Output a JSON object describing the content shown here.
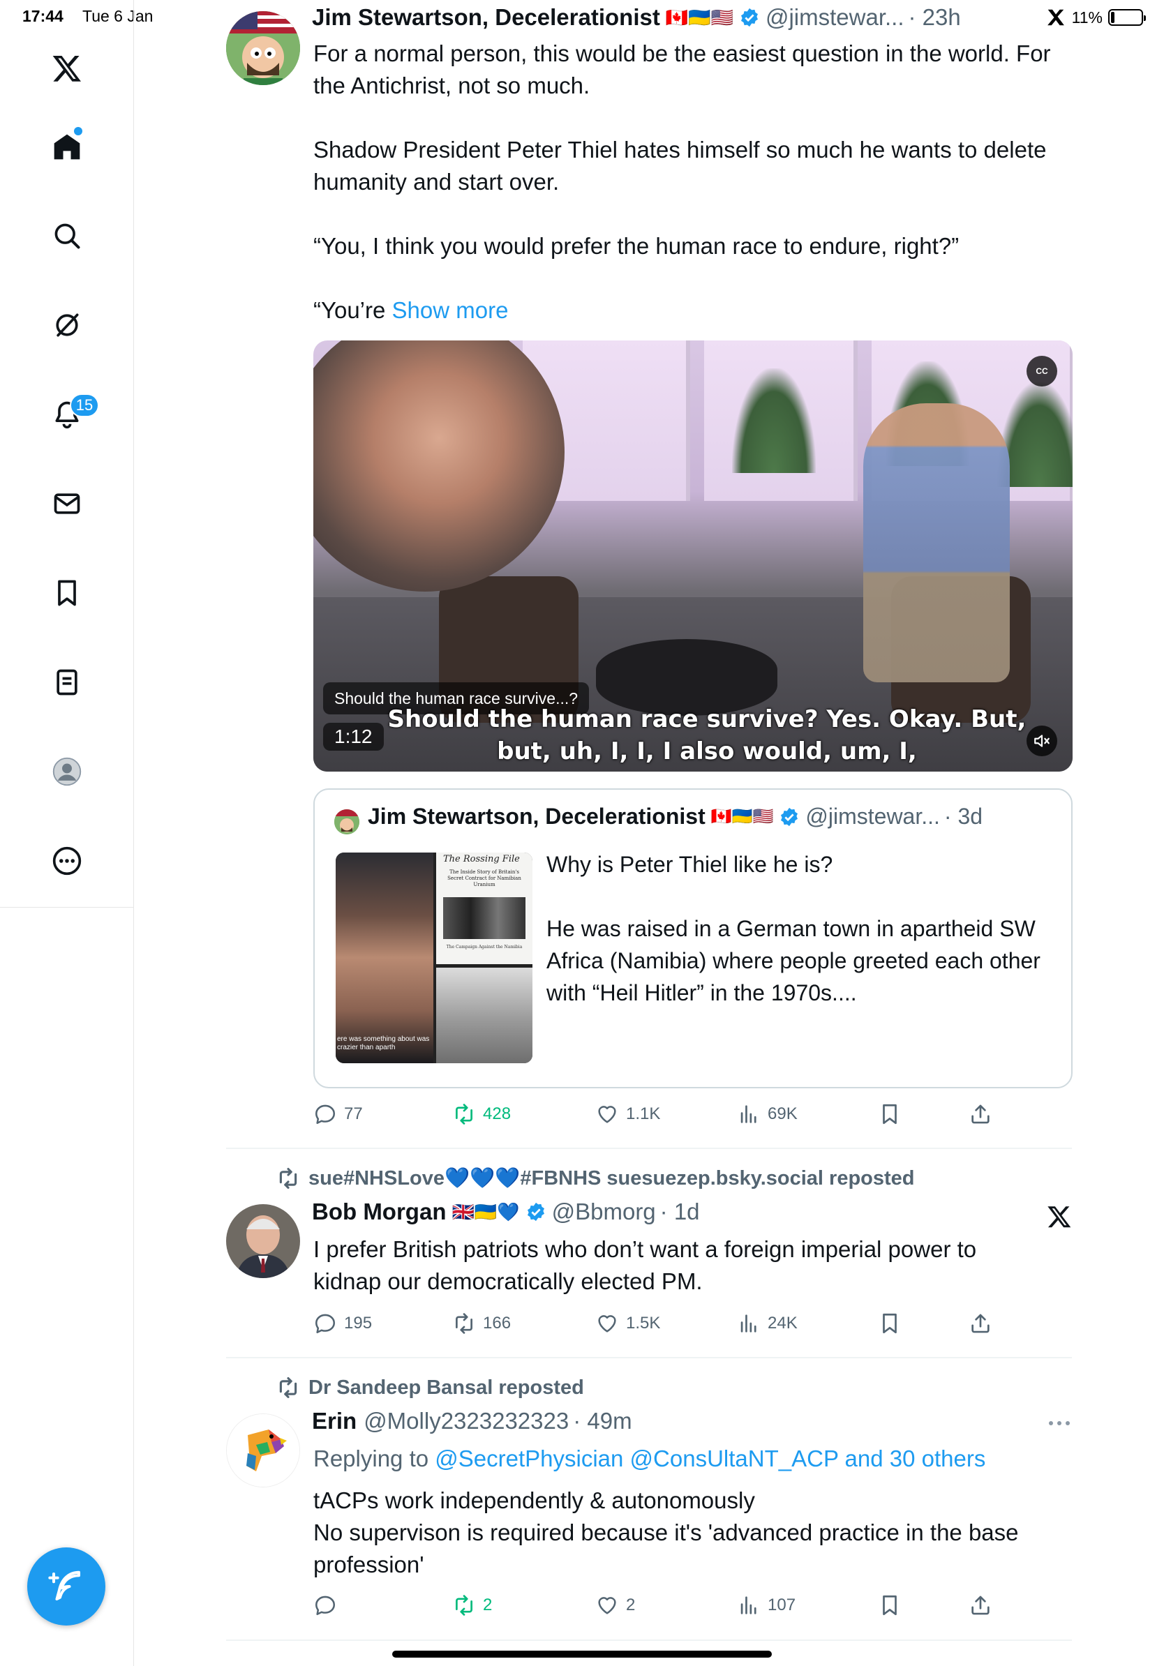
{
  "status_bar": {
    "time": "17:44",
    "date": "Tue 6 Jan",
    "battery": "11%",
    "battery_level": 0.11
  },
  "sidebar": {
    "items": [
      {
        "icon": "x-logo-icon"
      },
      {
        "icon": "home-icon"
      },
      {
        "icon": "search-icon"
      },
      {
        "icon": "grok-icon"
      },
      {
        "icon": "notifications-icon",
        "badge": "15"
      },
      {
        "icon": "messages-icon"
      },
      {
        "icon": "bookmarks-icon"
      },
      {
        "icon": "lists-icon"
      },
      {
        "icon": "profile-icon"
      },
      {
        "icon": "more-icon"
      }
    ],
    "compose_icon": "compose-icon"
  },
  "tweet1": {
    "name": "Jim Stewartson, Decelerationist",
    "flags": [
      "🇨🇦",
      "🇺🇦",
      "🇺🇸"
    ],
    "handle": "@jimstewar...",
    "time": "· 23h",
    "text_para1": "For a normal person, this would be the easiest question in the world. For the Antichrist, not so much.",
    "text_para2": "Shadow President Peter Thiel hates himself so much he wants to delete humanity and start over.",
    "text_para3": "“You, I think you would prefer the human race to endure, right?”",
    "text_para4": "“You’re",
    "show_more": "Show more",
    "video": {
      "cc": "CC",
      "title": "Should the human race survive...?",
      "subtitle": "Should the human race survive? Yes. Okay. But, but, uh, I, I, I also would, um, I,",
      "duration": "1:12"
    },
    "quote": {
      "name": "Jim Stewartson, Decelerationist",
      "flags": [
        "🇨🇦",
        "🇺🇦",
        "🇺🇸"
      ],
      "handle": "@jimstewar...",
      "time": "· 3d",
      "thumb_book_title": "The Rossing File",
      "thumb_book_subtitle": "The Inside Story of Britain's Secret Contract for Namibian Uranium",
      "thumb_book_footer": "The Campaign Against the Namibia",
      "thumb_caption": "ere was something about was crazier than aparth",
      "text_para1": "Why is Peter Thiel like he is?",
      "text_para2": "He was raised in a German town in apartheid SW Africa (Namibia) where people greeted each other with “Heil Hitler” in the 1970s...."
    },
    "stats": {
      "replies": "77",
      "reposts": "428",
      "likes": "1.1K",
      "views": "69K"
    }
  },
  "tweet2": {
    "repost_label": "sue#NHSLove💙💙💙#FBNHS suesuezep.bsky.social reposted",
    "name": "Bob Morgan",
    "flags": [
      "🇬🇧",
      "🇺🇦",
      "💙"
    ],
    "handle": "@Bbmorg",
    "time": "· 1d",
    "text": "I prefer British patriots who don’t want a foreign imperial power to kidnap our democratically elected PM.",
    "stats": {
      "replies": "195",
      "reposts": "166",
      "likes": "1.5K",
      "views": "24K"
    }
  },
  "tweet3": {
    "repost_label": "Dr Sandeep Bansal reposted",
    "name": "Erin",
    "handle": "@Molly2323232323",
    "time": "· 49m",
    "replying_prefix": "Replying to ",
    "replying_to": "@SecretPhysician @ConsUltaNT_ACP and 30 others",
    "text_line1": "tACPs work independently & autonomously",
    "text_line2": "No supervison is required because it's 'advanced practice in the base profession'",
    "stats": {
      "replies": "",
      "reposts": "2",
      "likes": "2",
      "views": "107"
    }
  },
  "colors": {
    "accent": "#1d9bf0",
    "repost_green": "#00ba7c",
    "muted": "#536471",
    "text": "#0f1419"
  }
}
